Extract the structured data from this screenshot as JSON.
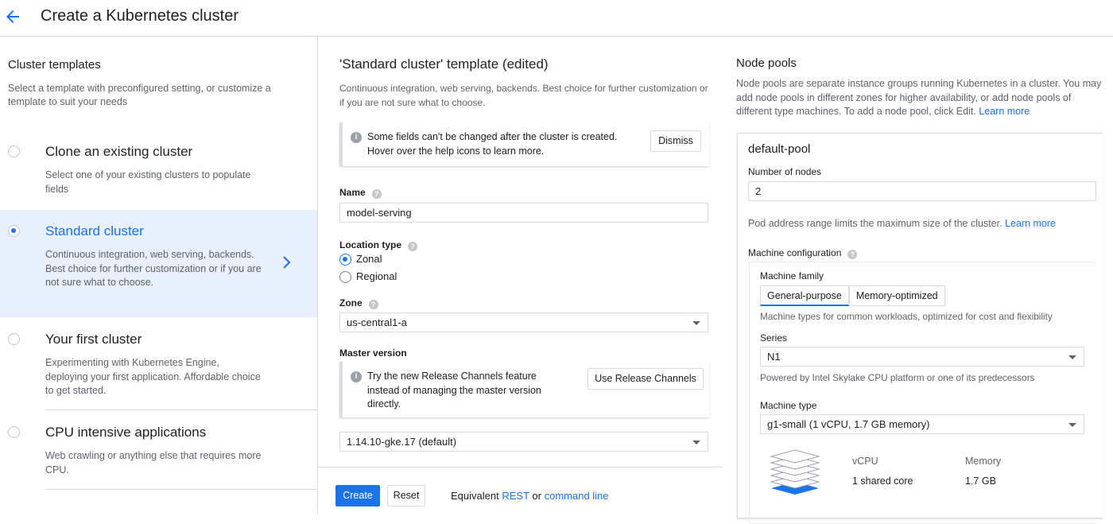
{
  "header": {
    "title": "Create a Kubernetes cluster"
  },
  "templates_panel": {
    "title": "Cluster templates",
    "subtitle": "Select a template with preconfigured setting, or customize a template to suit your needs",
    "items": [
      {
        "name": "Clone an existing cluster",
        "desc": "Select one of your existing clusters to populate fields",
        "selected": false
      },
      {
        "name": "Standard cluster",
        "desc": "Continuous integration, web serving, backends. Best choice for further customization or if you are not sure what to choose.",
        "selected": true
      },
      {
        "name": "Your first cluster",
        "desc": "Experimenting with Kubernetes Engine, deploying your first application. Affordable choice to get started.",
        "selected": false
      },
      {
        "name": "CPU intensive applications",
        "desc": "Web crawling or anything else that requires more CPU.",
        "selected": false
      }
    ]
  },
  "form": {
    "title": "'Standard cluster' template (edited)",
    "subtitle": "Continuous integration, web serving, backends. Best choice for further customization or if you are not sure what to choose.",
    "notice": {
      "text": "Some fields can't be changed after the cluster is created. Hover over the help icons to learn more.",
      "button": "Dismiss"
    },
    "name_label": "Name",
    "name_value": "model-serving",
    "location_label": "Location type",
    "location_options": [
      "Zonal",
      "Regional"
    ],
    "location_selected": "Zonal",
    "zone_label": "Zone",
    "zone_value": "us-central1-a",
    "master_label": "Master version",
    "release_notice": {
      "text": "Try the new Release Channels feature instead of managing the master version directly.",
      "button": "Use Release Channels"
    },
    "master_value": "1.14.10-gke.17 (default)",
    "create_button": "Create",
    "reset_button": "Reset",
    "equivalent_text": "Equivalent",
    "rest_link": "REST",
    "or_text": "or",
    "cmd_link": "command line"
  },
  "node_pools": {
    "title": "Node pools",
    "desc": "Node pools are separate instance groups running Kubernetes in a cluster. You may add node pools in different zones for higher availability, or add node pools of different type machines. To add a node pool, click Edit.",
    "learn_more": "Learn more",
    "pool": {
      "name": "default-pool",
      "nodes_label": "Number of nodes",
      "nodes_value": "2",
      "pod_hint": "Pod address range limits the maximum size of the cluster.",
      "pod_learn_more": "Learn more",
      "machine_config_label": "Machine configuration",
      "family_label": "Machine family",
      "family_tabs": [
        "General-purpose",
        "Memory-optimized"
      ],
      "family_selected": "General-purpose",
      "family_hint": "Machine types for common workloads, optimized for cost and flexibility",
      "series_label": "Series",
      "series_value": "N1",
      "series_hint": "Powered by Intel Skylake CPU platform or one of its predecessors",
      "type_label": "Machine type",
      "type_value": "g1-small (1 vCPU, 1.7 GB memory)",
      "vcpu_label": "vCPU",
      "vcpu_value": "1 shared core",
      "memory_label": "Memory",
      "memory_value": "1.7 GB"
    }
  },
  "colors": {
    "accent": "#1a73e8",
    "selected_bg": "#e8f0fe",
    "border": "#dadce0",
    "muted_text": "#5f6368"
  }
}
